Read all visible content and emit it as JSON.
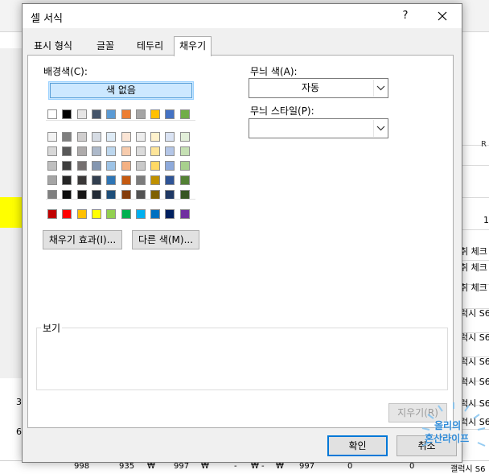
{
  "dialog": {
    "title": "셀 서식",
    "help_label": "?",
    "tabs": [
      {
        "label": "표시 형식",
        "active": false
      },
      {
        "label": "글꼴",
        "active": false
      },
      {
        "label": "테두리",
        "active": false
      },
      {
        "label": "채우기",
        "active": true
      }
    ]
  },
  "fill": {
    "background_color_label": "배경색(C):",
    "no_color_label": "색 없음",
    "auto_row": [
      "#ffffff",
      "#000000",
      "#e7e6e6",
      "#44546a",
      "#5b9bd5",
      "#ed7d31",
      "#a5a5a5",
      "#ffc000",
      "#4472c4",
      "#70ad47"
    ],
    "theme_rows": [
      [
        "#f2f2f2",
        "#7f7f7f",
        "#d0cece",
        "#d6dce4",
        "#deebf6",
        "#fbe5d5",
        "#ededed",
        "#fff2cc",
        "#dae3f3",
        "#e2efd9"
      ],
      [
        "#d8d8d8",
        "#595959",
        "#aeabab",
        "#adb9ca",
        "#bdd7ee",
        "#f7cbac",
        "#dbdbdb",
        "#fee599",
        "#b4c6e7",
        "#c5e0b3"
      ],
      [
        "#bfbfbf",
        "#3f3f3f",
        "#757070",
        "#8496b0",
        "#9dc3e6",
        "#f4b183",
        "#c9c9c9",
        "#ffd965",
        "#8eaadb",
        "#a8d08d"
      ],
      [
        "#a5a5a5",
        "#262626",
        "#3a3838",
        "#323f4f",
        "#2e75b5",
        "#c55a11",
        "#7b7b7b",
        "#bf9000",
        "#2f5496",
        "#538135"
      ],
      [
        "#7f7f7f",
        "#0c0c0c",
        "#171616",
        "#222a35",
        "#1e4e79",
        "#843c0b",
        "#525252",
        "#7f6000",
        "#1f3864",
        "#375623"
      ]
    ],
    "standard_row": [
      "#c00000",
      "#ff0000",
      "#ffc000",
      "#ffff00",
      "#92d050",
      "#00b050",
      "#00b0f0",
      "#0070c0",
      "#002060",
      "#7030a0"
    ],
    "fill_effects_button": "채우기 효과(I)...",
    "more_colors_button": "다른 색(M)...",
    "pattern_color_label": "무늬 색(A):",
    "pattern_color_value": "자동",
    "pattern_style_label": "무늬 스타일(P):",
    "pattern_style_value": "",
    "preview_label": "보기"
  },
  "footer": {
    "clear_button": "지우기(R)",
    "ok_button": "확인",
    "cancel_button": "취소"
  },
  "background_sheet": {
    "column_letter": "R",
    "right_cells": [
      "1",
      "취 체크",
      "취 체크",
      "취 체크",
      "럭시 S6",
      "럭시 S6",
      "럭시 S6",
      "럭시 S6",
      "럭시 S6",
      "럭시 S6"
    ],
    "left_cells": [
      "3",
      "6"
    ],
    "bottom_row": [
      "998",
      "935",
      "₩",
      "997",
      "₩",
      "-",
      "₩",
      "-",
      "₩",
      "997",
      "0",
      "0",
      "갤럭시 S6"
    ]
  },
  "watermark": {
    "line1": "올리의",
    "line2": "혼산라이프"
  }
}
